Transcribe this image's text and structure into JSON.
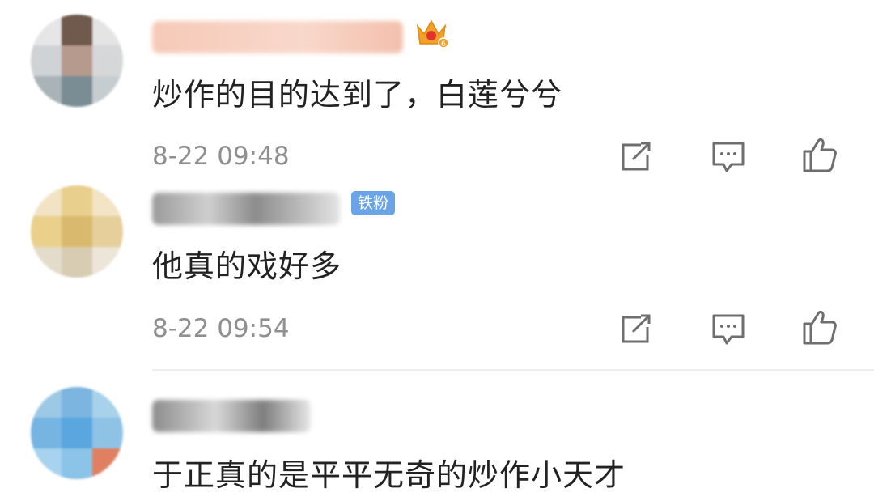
{
  "comments": [
    {
      "text": "炒作的目的达到了，白莲兮兮",
      "time": "8-22 09:48",
      "badge_icon": "crown-vip-icon"
    },
    {
      "text": "他真的戏好多",
      "time": "8-22 09:54",
      "badge_label": "铁粉"
    },
    {
      "text": "于正真的是平平无奇的炒作小天才"
    }
  ],
  "icons": {
    "share": "share-icon",
    "reply": "comment-icon",
    "like": "thumbs-up-icon"
  },
  "colors": {
    "text": "#222222",
    "timestamp": "#8f8f8f",
    "icon": "#6e6e6e",
    "badge_fan_bg": "#6aa3e6",
    "crown": "#f2a12b"
  }
}
